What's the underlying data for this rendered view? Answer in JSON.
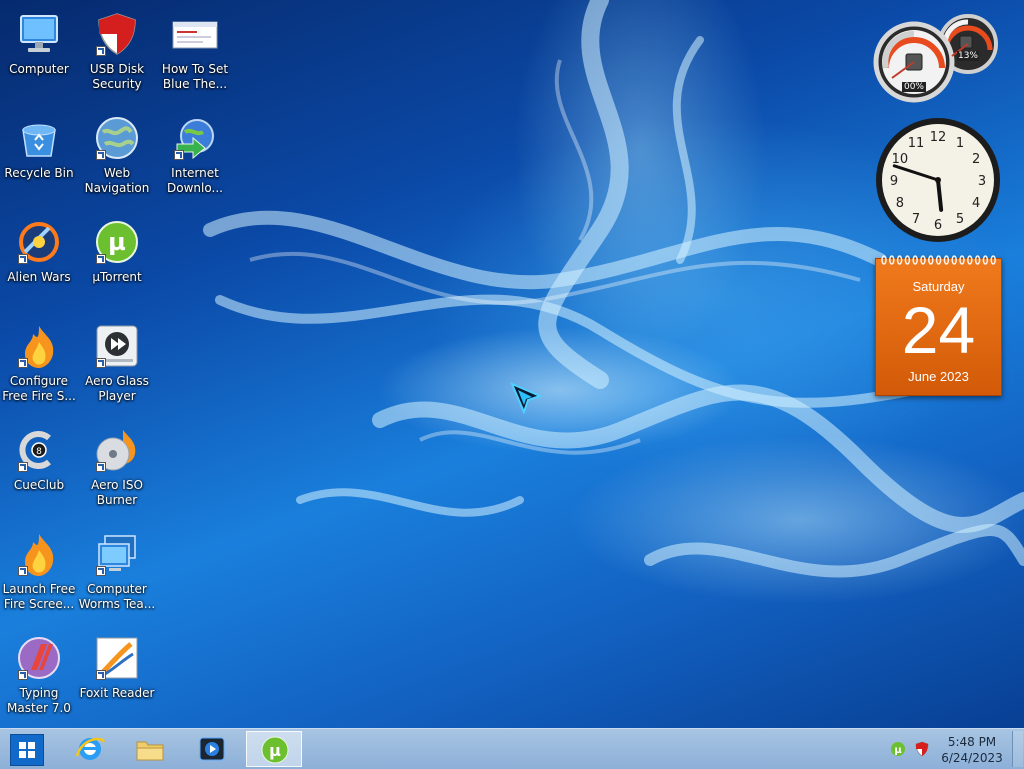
{
  "desktop": {
    "icons": [
      {
        "label": "Computer",
        "icon": "computer-monitor-icon"
      },
      {
        "label": "USB Disk\nSecurity",
        "icon": "shield-icon"
      },
      {
        "label": "How To Set\nBlue The...",
        "icon": "document-thumbnail-icon"
      },
      {
        "label": "Recycle Bin",
        "icon": "recycle-bin-icon"
      },
      {
        "label": "Web\nNavigation",
        "icon": "globe-icon"
      },
      {
        "label": "Internet\nDownlo...",
        "icon": "download-globe-icon"
      },
      {
        "label": "Alien Wars",
        "icon": "alien-wars-icon"
      },
      {
        "label": "µTorrent",
        "icon": "utorrent-icon"
      },
      {
        "label": "Configure\nFree Fire S...",
        "icon": "flame-icon"
      },
      {
        "label": "Aero Glass\nPlayer",
        "icon": "media-player-icon"
      },
      {
        "label": "CueClub",
        "icon": "cueclub-icon"
      },
      {
        "label": "Aero ISO\nBurner",
        "icon": "disc-burner-icon"
      },
      {
        "label": "Launch Free\nFire Scree...",
        "icon": "flame-icon"
      },
      {
        "label": "Computer\nWorms Tea...",
        "icon": "computer-screens-icon"
      },
      {
        "label": "Typing\nMaster 7.0",
        "icon": "typing-master-icon"
      },
      {
        "label": "Foxit Reader",
        "icon": "foxit-reader-icon"
      }
    ]
  },
  "gadgets": {
    "cpu_meter": {
      "cpu_text": "00%",
      "memory_text": "13%",
      "cpu_value": 0,
      "memory_value": 13
    },
    "clock": {
      "numerals": [
        "12",
        "1",
        "2",
        "3",
        "4",
        "5",
        "6",
        "7",
        "8",
        "9",
        "10",
        "11"
      ],
      "hour": 5,
      "minute": 48
    },
    "calendar": {
      "weekday": "Saturday",
      "day": "24",
      "month_year": "June 2023",
      "color": "#e8690f"
    }
  },
  "taskbar": {
    "start_icon": "windows-logo-icon",
    "pinned": [
      {
        "icon": "internet-explorer-icon",
        "active": false
      },
      {
        "icon": "file-explorer-icon",
        "active": false
      },
      {
        "icon": "media-player-icon",
        "active": false
      },
      {
        "icon": "utorrent-icon",
        "active": true
      }
    ],
    "tray": {
      "icons": [
        "utorrent-icon",
        "shield-icon"
      ],
      "time": "5:48 PM",
      "date": "6/24/2023"
    }
  },
  "colors": {
    "desktop": "#0b4aa8",
    "taskbar": "#9dbde0",
    "accent": "#1169c9"
  }
}
